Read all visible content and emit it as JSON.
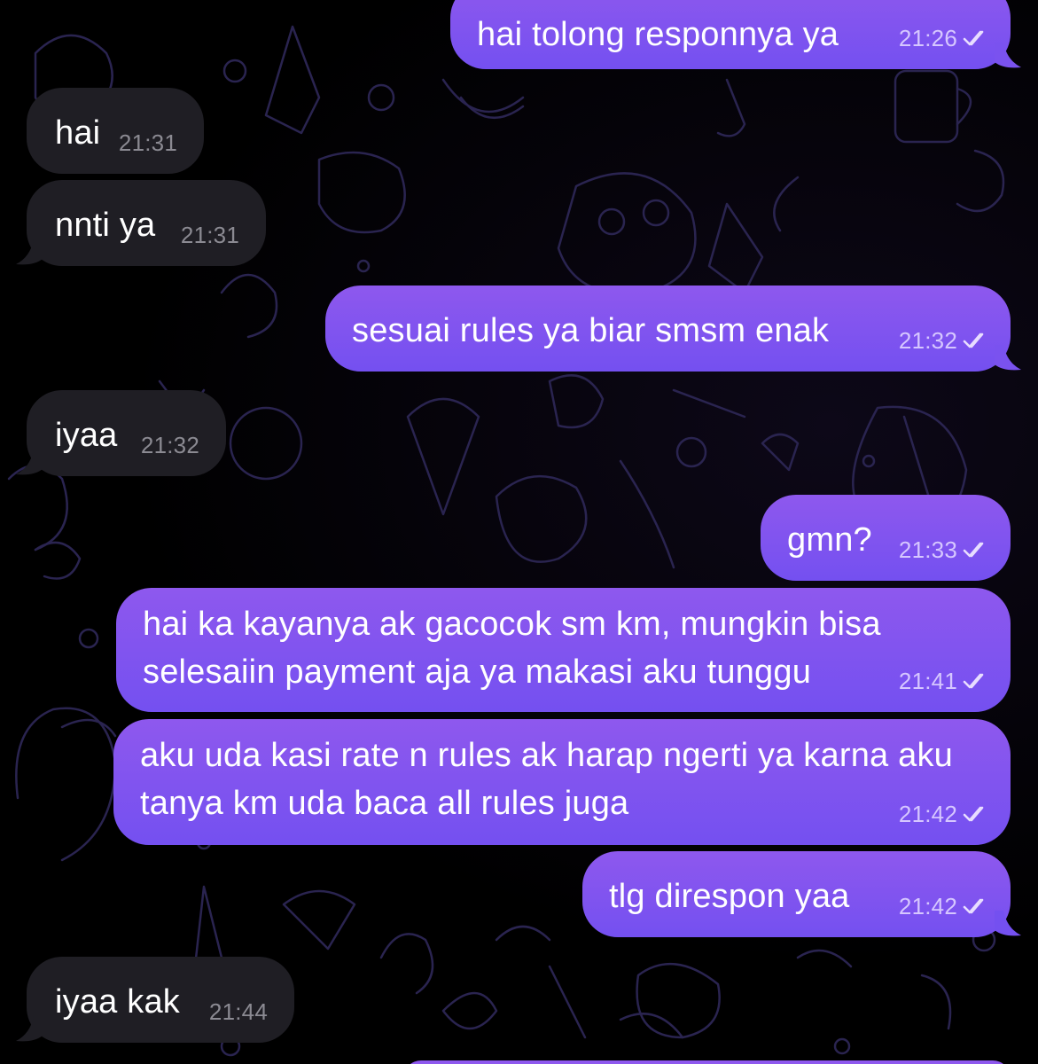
{
  "theme": {
    "incoming_bubble": "#1f1e24",
    "outgoing_bubble_top": "#8e58ee",
    "outgoing_bubble_bottom": "#7450f0",
    "background": "#000000",
    "doodle_color": "#2a2450"
  },
  "messages": [
    {
      "direction": "out",
      "text": "hai tolong responnya ya",
      "time": "21:26",
      "status": "read-double-check-icon"
    },
    {
      "direction": "in",
      "text": "hai",
      "time": "21:31"
    },
    {
      "direction": "in",
      "text": "nnti ya",
      "time": "21:31"
    },
    {
      "direction": "out",
      "text": "sesuai rules ya biar smsm enak",
      "time": "21:32",
      "status": "read-double-check-icon"
    },
    {
      "direction": "in",
      "text": "iyaa",
      "time": "21:32"
    },
    {
      "direction": "out",
      "text": "gmn?",
      "time": "21:33",
      "status": "read-double-check-icon"
    },
    {
      "direction": "out",
      "text": "hai ka kayanya ak gacocok sm km, mungkin bisa selesaiin payment aja ya makasi aku tunggu",
      "time": "21:41",
      "status": "read-double-check-icon"
    },
    {
      "direction": "out",
      "text": "aku uda kasi rate n rules ak harap ngerti ya karna aku tanya km uda baca all rules juga",
      "time": "21:42",
      "status": "read-double-check-icon"
    },
    {
      "direction": "out",
      "text": "tlg direspon yaa",
      "time": "21:42",
      "status": "read-double-check-icon"
    },
    {
      "direction": "in",
      "text": "iyaa kak",
      "time": "21:44"
    }
  ]
}
